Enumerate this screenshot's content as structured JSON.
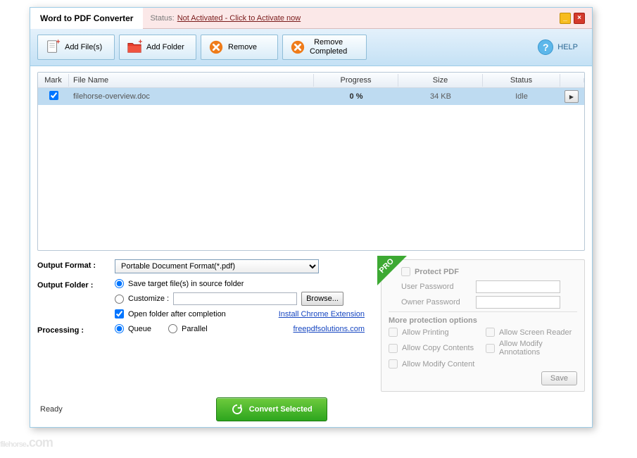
{
  "title": "Word to PDF Converter",
  "status_label": "Status:",
  "status_link": "Not Activated - Click to Activate now",
  "toolbar": {
    "add_files": "Add File(s)",
    "add_folder": "Add Folder",
    "remove": "Remove",
    "remove_completed_l1": "Remove",
    "remove_completed_l2": "Completed",
    "help": "HELP"
  },
  "table": {
    "headers": {
      "mark": "Mark",
      "name": "File Name",
      "progress": "Progress",
      "size": "Size",
      "status": "Status"
    },
    "rows": [
      {
        "name": "filehorse-overview.doc",
        "progress": "0 %",
        "size": "34 KB",
        "status": "Idle"
      }
    ]
  },
  "opts": {
    "output_format_label": "Output Format :",
    "output_format_value": "Portable Document Format(*.pdf)",
    "output_folder_label": "Output Folder :",
    "save_target": "Save target file(s) in source folder",
    "customize": "Customize :",
    "browse": "Browse...",
    "open_after": "Open folder after completion",
    "install_ext": "Install Chrome Extension",
    "site": "freepdfsolutions.com",
    "processing_label": "Processing :",
    "queue": "Queue",
    "parallel": "Parallel"
  },
  "pro": {
    "badge": "PRO",
    "protect": "Protect PDF",
    "user_pw": "User Password",
    "owner_pw": "Owner Password",
    "more": "More protection options",
    "allow_printing": "Allow Printing",
    "allow_copy": "Allow Copy Contents",
    "allow_modify": "Allow Modify Content",
    "allow_reader": "Allow Screen Reader",
    "allow_annot": "Allow Modify Annotations",
    "save": "Save"
  },
  "footer": {
    "status": "Ready",
    "convert": "Convert Selected"
  },
  "watermark": {
    "main": "filehorse",
    "tld": ".com"
  }
}
